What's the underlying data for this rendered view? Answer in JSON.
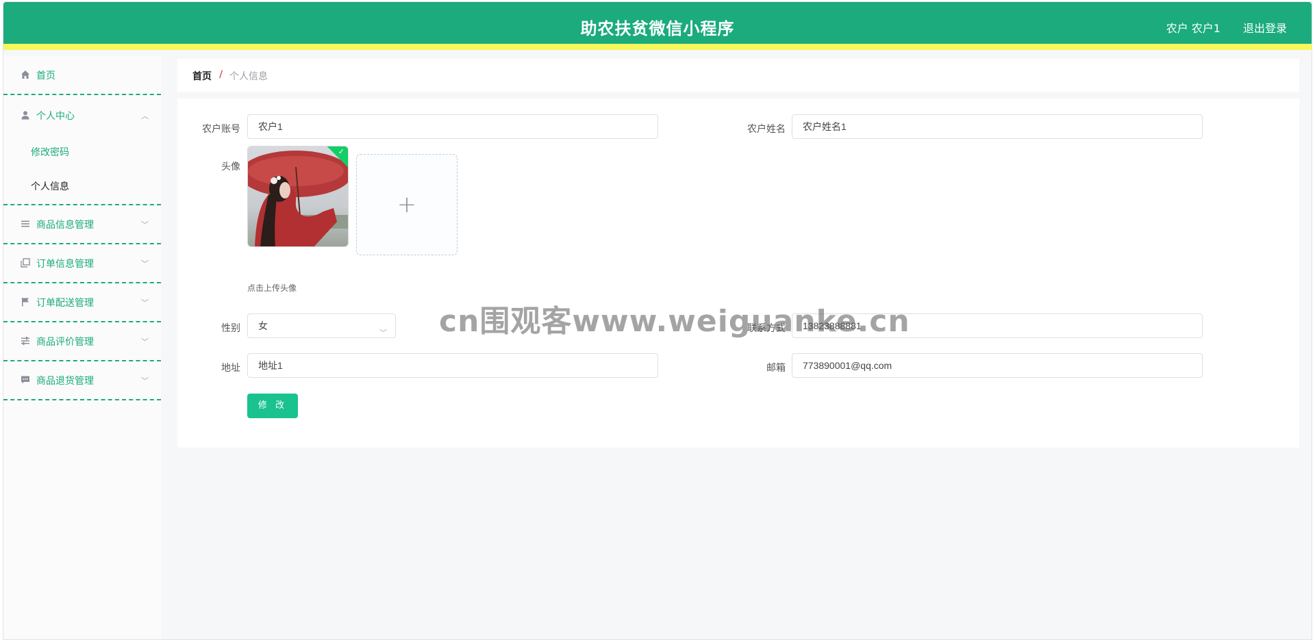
{
  "header": {
    "title": "助农扶贫微信小程序",
    "user": "农户 农户1",
    "logout": "退出登录",
    "colors": {
      "primary": "#1bab7c",
      "strip": "#f5f75a"
    }
  },
  "sidebar": {
    "home": {
      "label": "首页",
      "icon": "home-icon"
    },
    "personal": {
      "label": "个人中心",
      "icon": "user-icon",
      "items": [
        {
          "label": "修改密码"
        },
        {
          "label": "个人信息"
        }
      ]
    },
    "groups": [
      {
        "label": "商品信息管理",
        "icon": "list-icon"
      },
      {
        "label": "订单信息管理",
        "icon": "copy-icon"
      },
      {
        "label": "订单配送管理",
        "icon": "flag-icon"
      },
      {
        "label": "商品评价管理",
        "icon": "sliders-icon"
      },
      {
        "label": "商品退货管理",
        "icon": "chat-icon"
      }
    ]
  },
  "breadcrumb": {
    "home": "首页",
    "separator": "/",
    "current": "个人信息"
  },
  "form": {
    "account": {
      "label": "农户账号",
      "value": "农户1"
    },
    "name": {
      "label": "农户姓名",
      "value": "农户姓名1"
    },
    "avatar": {
      "label": "头像",
      "hint": "点击上传头像"
    },
    "gender": {
      "label": "性别",
      "value": "女"
    },
    "phone": {
      "label": "联系方式",
      "value": "13823888881"
    },
    "address": {
      "label": "地址",
      "value": "地址1"
    },
    "email": {
      "label": "邮箱",
      "value": "773890001@qq.com"
    },
    "submit": "修 改"
  },
  "watermark": "cn围观客www.weiguanke.cn"
}
